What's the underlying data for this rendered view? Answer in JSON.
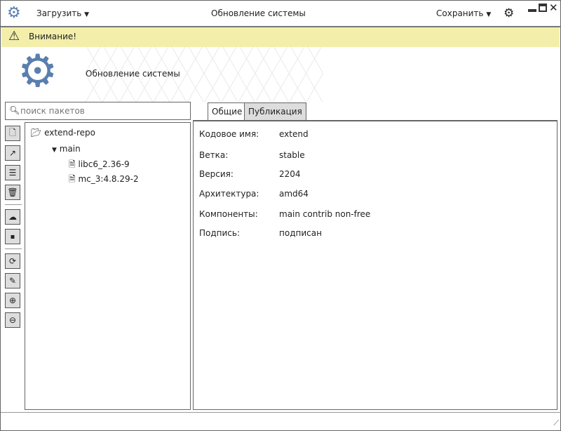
{
  "titlebar": {
    "menu_load": "Загрузить",
    "title": "Обновление системы",
    "menu_save": "Сохранить"
  },
  "warning": {
    "text": "Внимание!"
  },
  "header": {
    "title": "Обновление системы"
  },
  "search": {
    "placeholder": "поиск пакетов"
  },
  "tree": {
    "root": "extend-repo",
    "branch": "main",
    "files": [
      "libc6_2.36-9",
      "mc_3:4.8.29-2"
    ]
  },
  "tabs": [
    "Общие",
    "Публикация"
  ],
  "props": [
    {
      "label": "Кодовое имя:",
      "value": "extend"
    },
    {
      "label": "Ветка:",
      "value": "stable"
    },
    {
      "label": "Версия:",
      "value": "2204"
    },
    {
      "label": "Архитектура:",
      "value": "amd64"
    },
    {
      "label": "Компоненты:",
      "value": "main contrib non-free"
    },
    {
      "label": "Подпись:",
      "value": "подписан"
    }
  ],
  "colors": {
    "accent": "#5a7fae",
    "warning_bg": "#f3efaa"
  }
}
